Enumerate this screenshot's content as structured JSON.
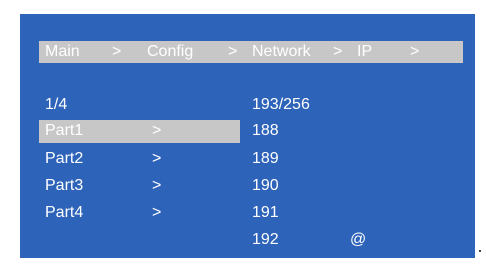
{
  "colors": {
    "screen_bg": "#2d63b9",
    "highlight": "#c7c7c7",
    "text": "#ffffff"
  },
  "breadcrumb": {
    "items": [
      "Main",
      ">",
      "Config",
      ">",
      "Network",
      ">",
      "IP",
      ">"
    ]
  },
  "left_panel": {
    "page_indicator": "1/4",
    "items": [
      {
        "label": "Part1",
        "arrow": ">",
        "selected": true
      },
      {
        "label": "Part2",
        "arrow": ">",
        "selected": false
      },
      {
        "label": "Part3",
        "arrow": ">",
        "selected": false
      },
      {
        "label": "Part4",
        "arrow": ">",
        "selected": false
      }
    ]
  },
  "right_panel": {
    "counter": "193/256",
    "values": [
      "188",
      "189",
      "190",
      "191",
      "192"
    ],
    "marker": "@"
  }
}
